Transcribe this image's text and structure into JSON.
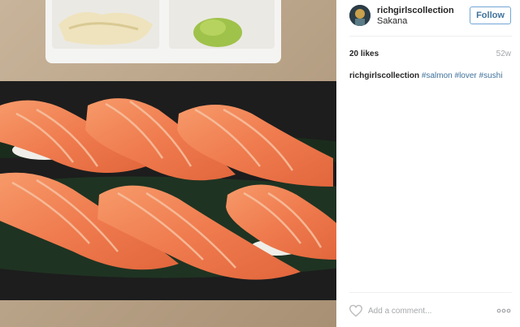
{
  "post": {
    "username": "richgirlscollection",
    "location": "Sakana",
    "follow_label": "Follow",
    "likes": "20 likes",
    "age": "52w",
    "caption": {
      "username": "richgirlscollection",
      "hashtags": [
        "#salmon",
        "#lover",
        "#sushi"
      ]
    }
  },
  "footer": {
    "comment_placeholder": "Add a comment...",
    "icons": {
      "like": "heart-icon",
      "more": "more-options-icon"
    }
  },
  "colors": {
    "follow_border": "#70a6d6",
    "link": "#3f729b",
    "muted": "#a5a7aa",
    "salmon": "#ef7b4e"
  }
}
